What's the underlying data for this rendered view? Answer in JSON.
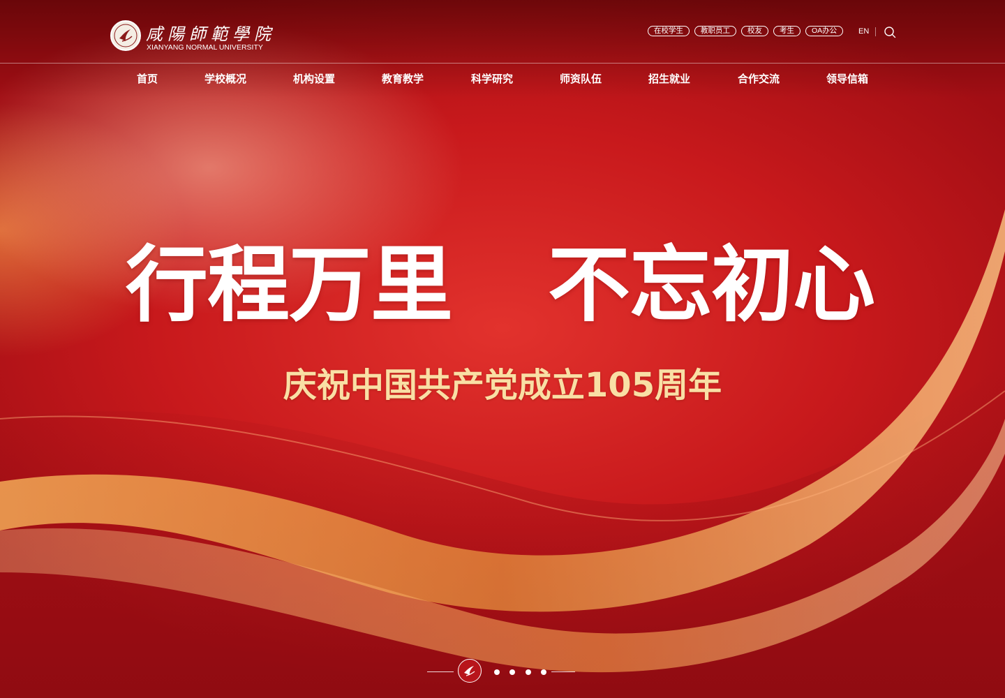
{
  "site": {
    "logo_cn": "咸陽師範學院",
    "logo_en": "XIANYANG NORMAL UNIVERSITY"
  },
  "quick_links": [
    "在校学生",
    "教职员工",
    "校友",
    "考生",
    "OA办公"
  ],
  "language_toggle": "EN",
  "nav": [
    "首页",
    "学校概况",
    "机构设置",
    "教育教学",
    "科学研究",
    "师资队伍",
    "招生就业",
    "合作交流",
    "领导信箱"
  ],
  "hero": {
    "headline_left": "行程万里",
    "headline_right": "不忘初心",
    "subheadline": "庆祝中国共产党成立105周年"
  },
  "slider": {
    "total_dots": 4
  },
  "colors": {
    "primary_red": "#c8191c",
    "subheadline_gold": "#f9dfa5",
    "text_white": "#ffffff"
  },
  "icons": [
    "logo-seal",
    "search-icon",
    "slider-logo-icon"
  ]
}
